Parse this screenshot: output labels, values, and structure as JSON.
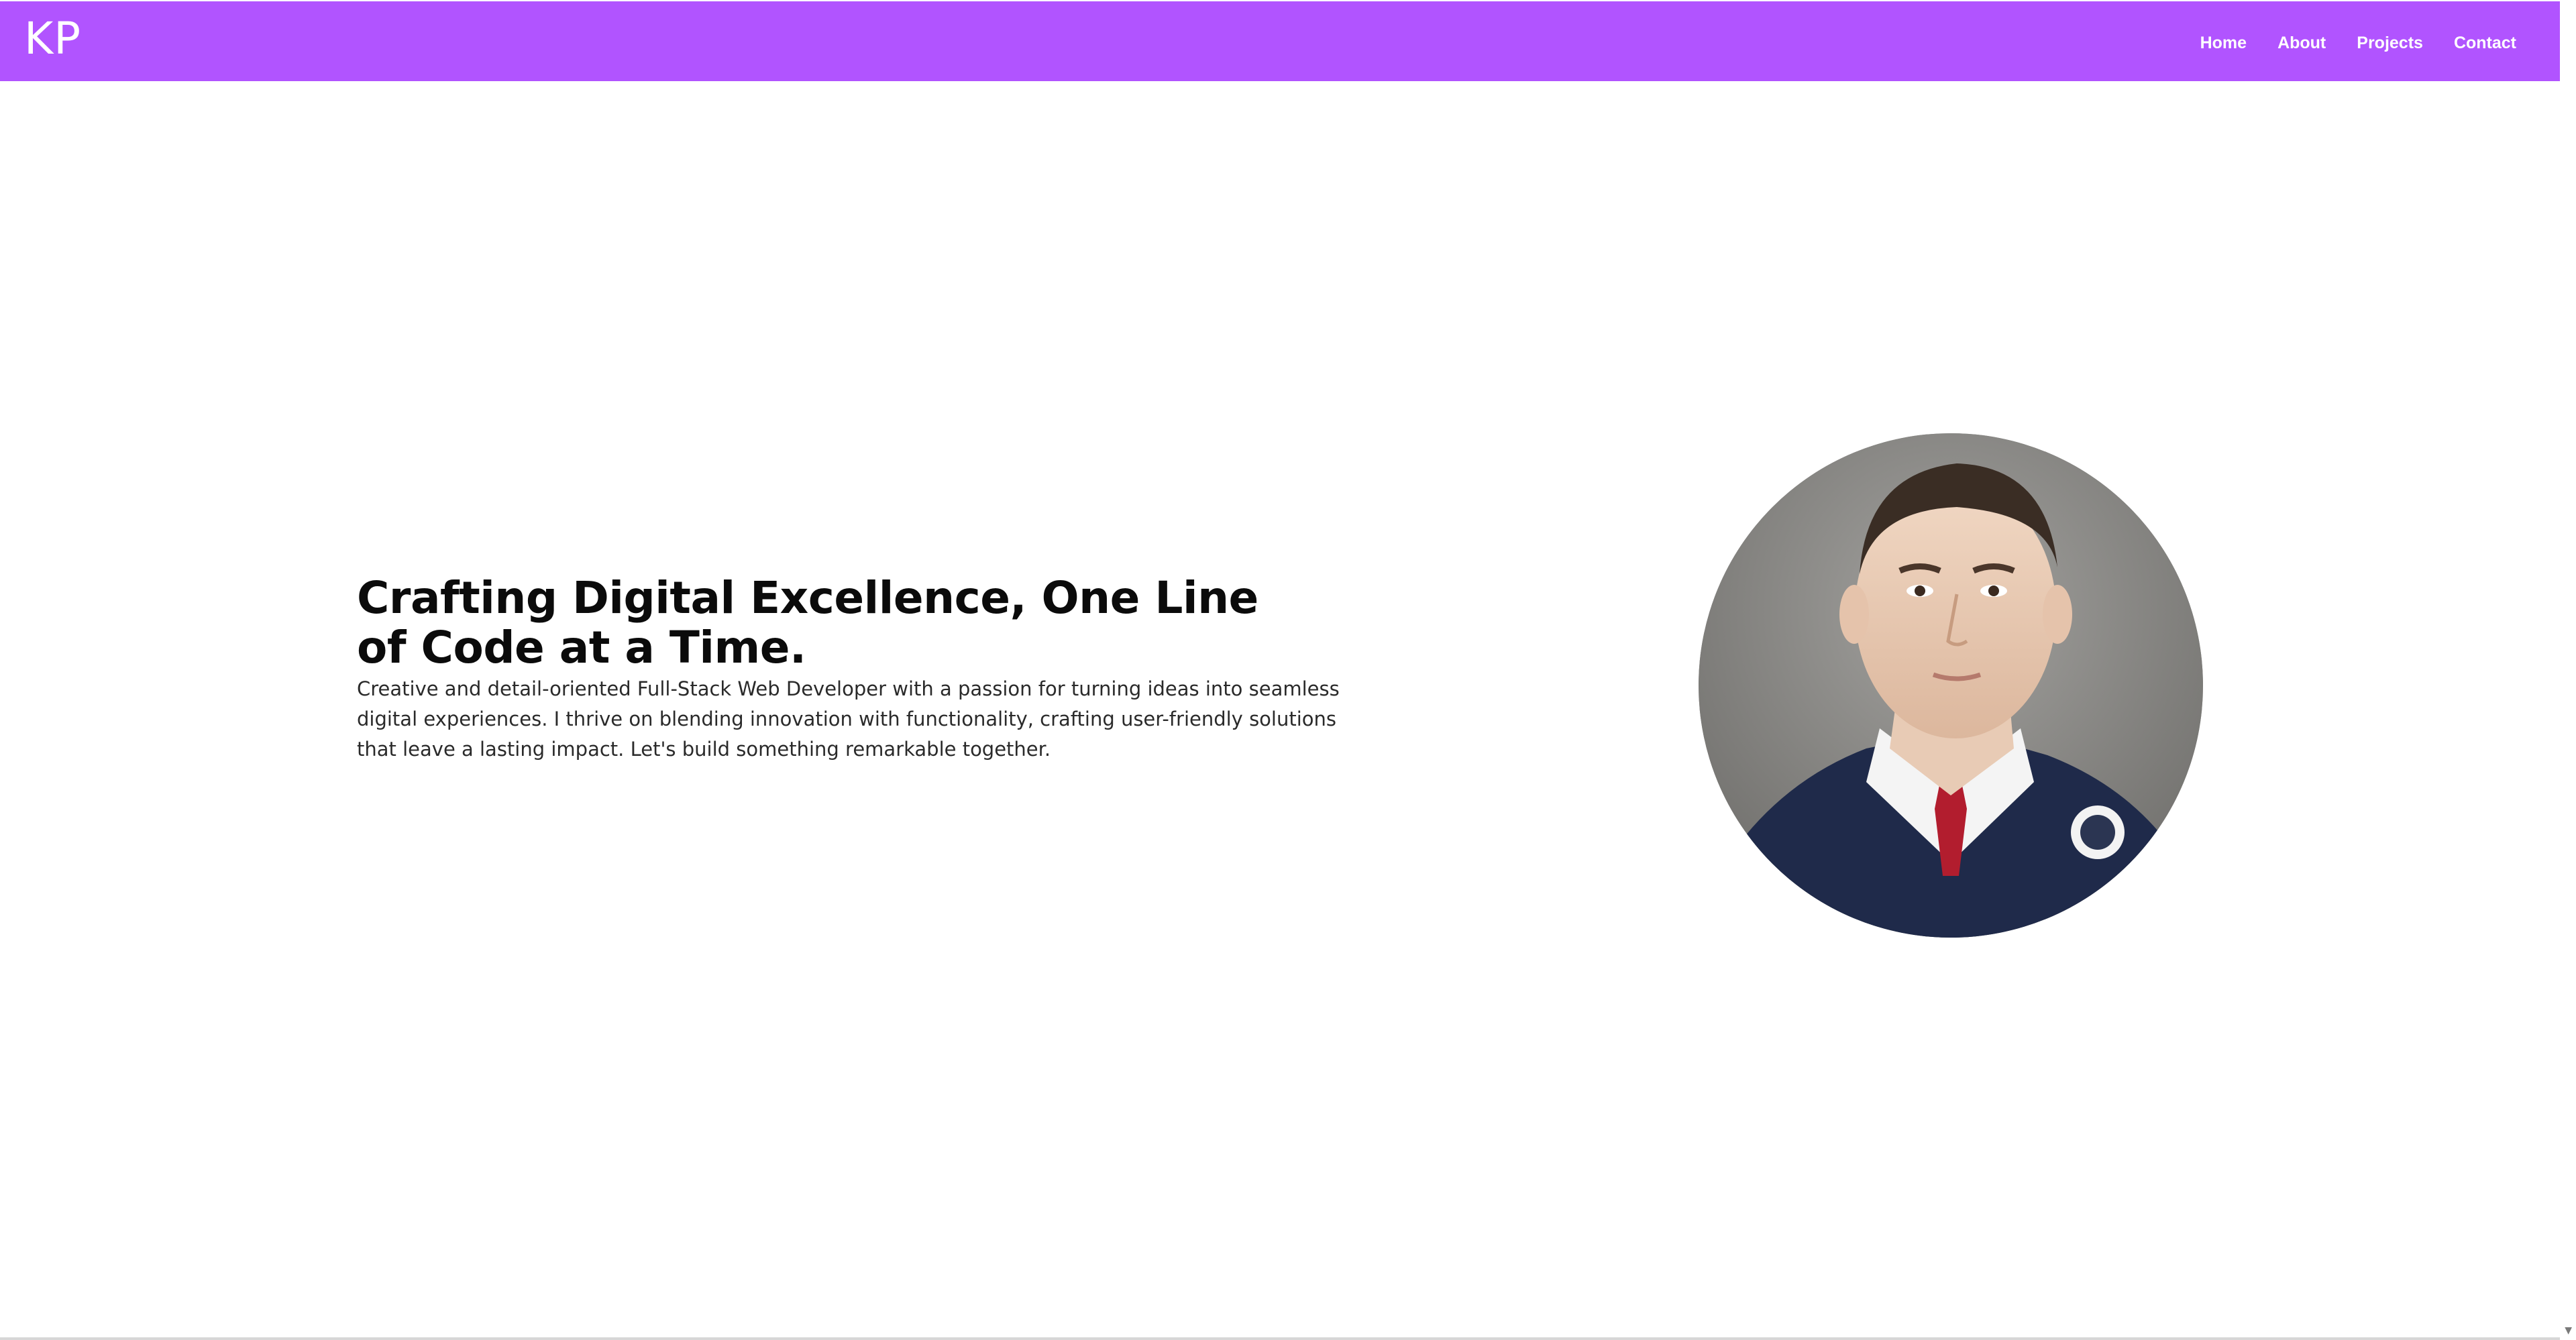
{
  "header": {
    "logo": "KP",
    "nav": [
      {
        "label": "Home"
      },
      {
        "label": "About"
      },
      {
        "label": "Projects"
      },
      {
        "label": "Contact"
      }
    ],
    "background_color": "#b154ff"
  },
  "hero": {
    "title": "Crafting Digital Excellence, One Line of Code at a Time.",
    "description": "Creative and detail-oriented Full-Stack Web Developer with a passion for turning ideas into seamless digital experiences. I thrive on blending innovation with functionality, crafting user-friendly solutions that leave a lasting impact. Let's build something remarkable together."
  },
  "portrait": {
    "icon": "profile-photo"
  },
  "colors": {
    "accent": "#b154ff",
    "text": "#0b0b0b",
    "background": "#ffffff"
  }
}
